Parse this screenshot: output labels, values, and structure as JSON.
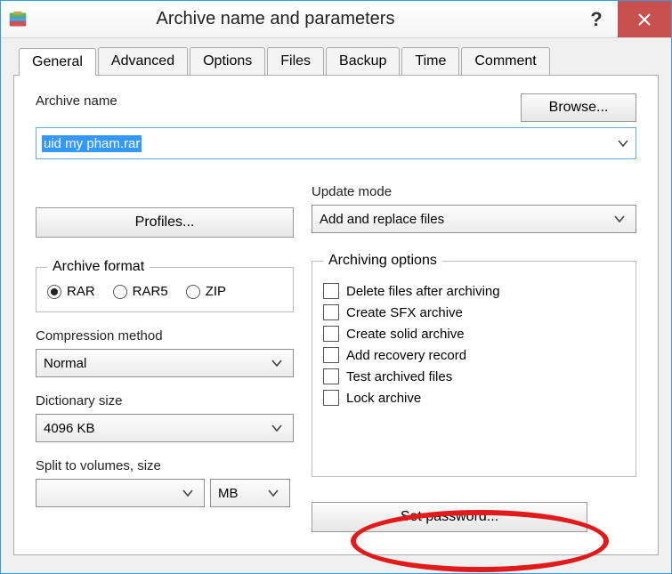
{
  "window": {
    "title": "Archive name and parameters"
  },
  "tabs": [
    "General",
    "Advanced",
    "Options",
    "Files",
    "Backup",
    "Time",
    "Comment"
  ],
  "active_tab": 0,
  "archive": {
    "label": "Archive name",
    "value": "uid my pham.rar",
    "browse_label": "Browse..."
  },
  "profiles_label": "Profiles...",
  "update_mode": {
    "label": "Update mode",
    "value": "Add and replace files"
  },
  "archive_format": {
    "label": "Archive format",
    "options": [
      "RAR",
      "RAR5",
      "ZIP"
    ],
    "selected": 0
  },
  "compression": {
    "label": "Compression method",
    "value": "Normal"
  },
  "dictionary": {
    "label": "Dictionary size",
    "value": "4096 KB"
  },
  "split": {
    "label": "Split to volumes, size",
    "value": "",
    "unit": "MB"
  },
  "archiving_options": {
    "label": "Archiving options",
    "items": [
      "Delete files after archiving",
      "Create SFX archive",
      "Create solid archive",
      "Add recovery record",
      "Test archived files",
      "Lock archive"
    ]
  },
  "set_password_label": "Set password..."
}
